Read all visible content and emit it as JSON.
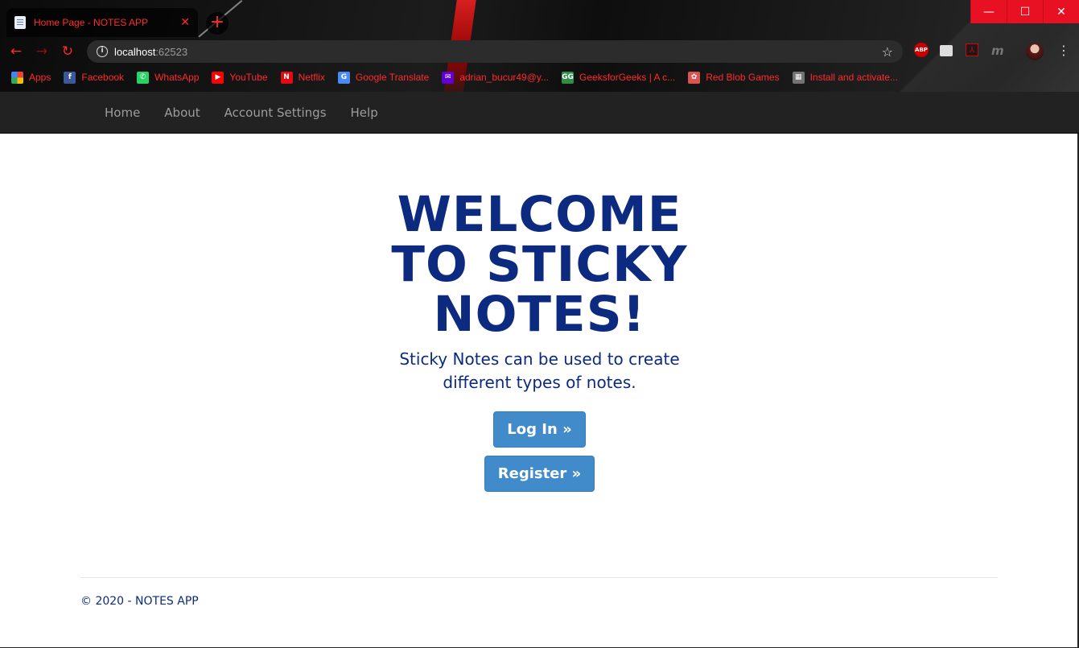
{
  "browser": {
    "tab": {
      "title": "Home Page - NOTES APP",
      "close_glyph": "✕"
    },
    "new_tab_glyph": "+",
    "window_controls": {
      "minimize": "—",
      "maximize": "☐",
      "close": "✕"
    },
    "nav": {
      "back": "←",
      "forward": "→",
      "reload": "↻"
    },
    "address": {
      "host": "localhost",
      "port": ":62523",
      "star_glyph": "☆"
    },
    "extensions": {
      "abp": "ABP",
      "pdf": "⅄",
      "m": "m",
      "menu": "⋮"
    },
    "bookmarks": [
      {
        "label": "Apps",
        "icon": "apps-grid-icon",
        "color": "#4285f4"
      },
      {
        "label": "Facebook",
        "icon": "facebook-icon",
        "color": "#3b5998",
        "glyph": "f"
      },
      {
        "label": "WhatsApp",
        "icon": "whatsapp-icon",
        "color": "#25d366",
        "glyph": "✆"
      },
      {
        "label": "YouTube",
        "icon": "youtube-icon",
        "color": "#ff0000",
        "glyph": "▶"
      },
      {
        "label": "Netflix",
        "icon": "netflix-icon",
        "color": "#e50914",
        "glyph": "N"
      },
      {
        "label": "Google Translate",
        "icon": "google-translate-icon",
        "color": "#4a8af4",
        "glyph": "G"
      },
      {
        "label": "adrian_bucur49@y...",
        "icon": "yahoo-mail-icon",
        "color": "#6001d2",
        "glyph": "✉"
      },
      {
        "label": "GeeksforGeeks | A c...",
        "icon": "geeksforgeeks-icon",
        "color": "#2f8d46",
        "glyph": "GG"
      },
      {
        "label": "Red Blob Games",
        "icon": "red-blob-games-icon",
        "color": "#d9534f",
        "glyph": "✿"
      },
      {
        "label": "Install and activate...",
        "icon": "microsoft-icon",
        "color": "#737373",
        "glyph": "▦"
      }
    ]
  },
  "site_nav": {
    "items": [
      "Home",
      "About",
      "Account Settings",
      "Help"
    ]
  },
  "hero": {
    "title": "WELCOME TO STICKY NOTES!",
    "subtitle": "Sticky Notes can be used to create different types of notes.",
    "login_button": "Log In »",
    "register_button": "Register »"
  },
  "footer": {
    "text": "© 2020 - NOTES APP"
  },
  "colors": {
    "accent_red": "#ff2b2b",
    "brand_blue": "#0b2a80",
    "button_blue": "#428bca",
    "nav_bg": "#222222"
  }
}
